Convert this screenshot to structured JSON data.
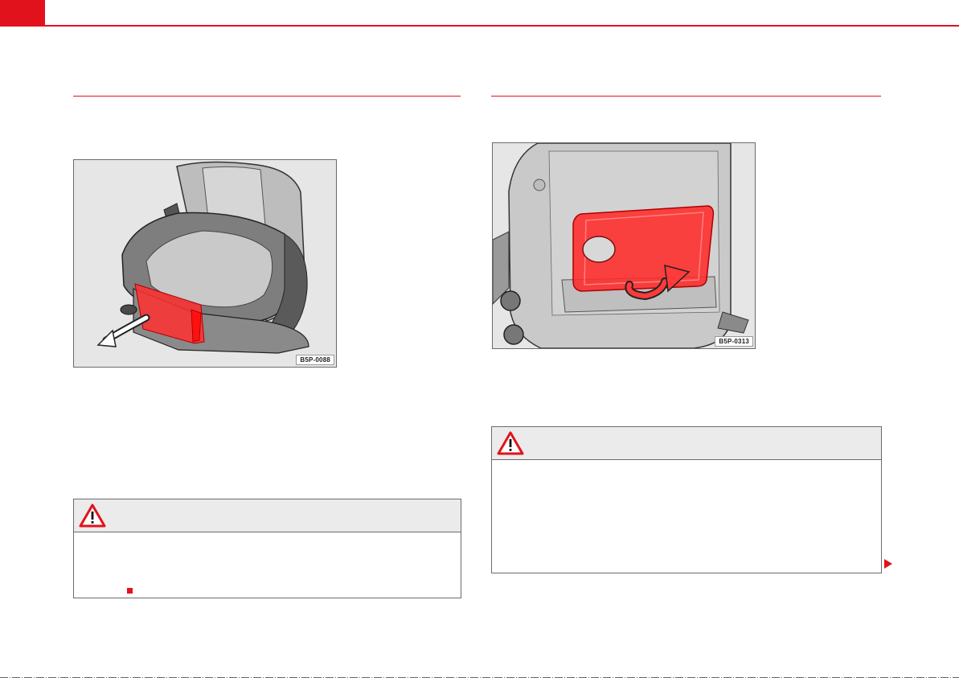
{
  "figures": {
    "left": {
      "code": "B5P-0088",
      "icon": "seat-drawer-illustration"
    },
    "right": {
      "code": "B5P-0313",
      "icon": "seatback-tray-illustration"
    }
  },
  "warnings": {
    "icon": "warning-triangle-icon"
  },
  "colors": {
    "accent": "#e2121c",
    "box_header": "#ebebeb",
    "border": "#6b6b6b"
  }
}
